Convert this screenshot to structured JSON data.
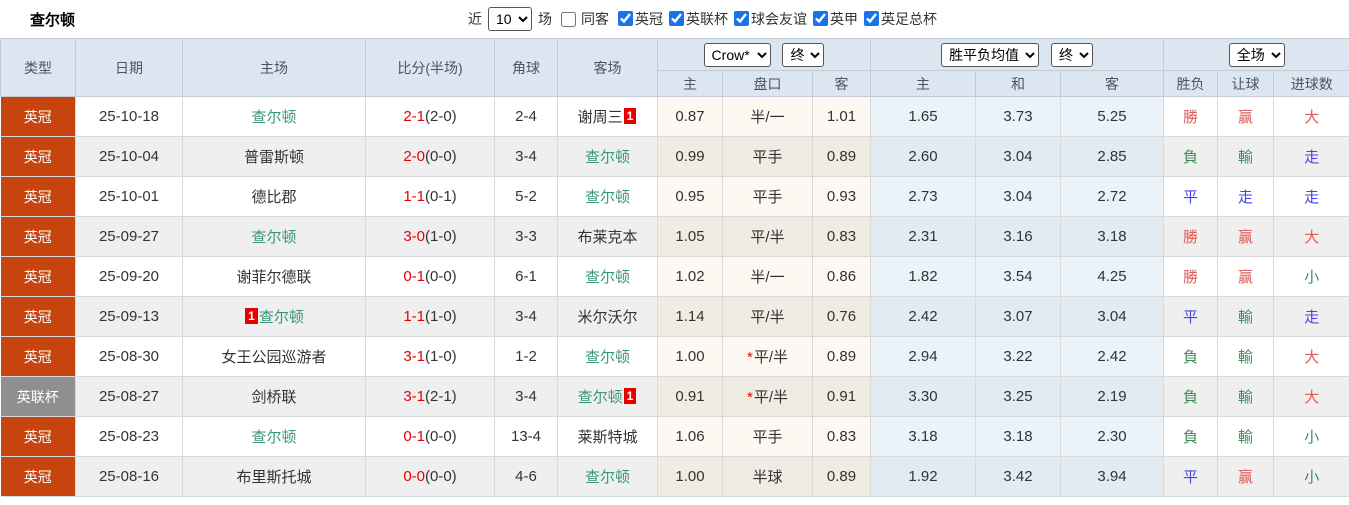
{
  "toolbar": {
    "title": "查尔顿",
    "recent_label": "近",
    "recent_value": "10",
    "games_label": "场",
    "same_venue_label": "同客",
    "same_venue_checked": false,
    "leagues": [
      {
        "label": "英冠",
        "checked": true
      },
      {
        "label": "英联杯",
        "checked": true
      },
      {
        "label": "球会友谊",
        "checked": true
      },
      {
        "label": "英甲",
        "checked": true
      },
      {
        "label": "英足总杯",
        "checked": true
      }
    ]
  },
  "table": {
    "headers": {
      "type": "类型",
      "date": "日期",
      "home": "主场",
      "score": "比分(半场)",
      "corner": "角球",
      "away": "客场",
      "odds_company_select": "Crow*",
      "odds_state_select": "终",
      "avg_select": "胜平负均值",
      "avg_state_select": "终",
      "scope_select": "全场",
      "odds_home": "主",
      "odds_handicap": "盘口",
      "odds_away": "客",
      "avg_home": "主",
      "avg_draw": "和",
      "avg_away": "客",
      "result": "胜负",
      "handicap_result": "让球",
      "goals_result": "进球数"
    },
    "rows": [
      {
        "league": "英冠",
        "league_style": "primary",
        "date": "25-10-18",
        "home": {
          "name": "查尔顿",
          "self": true,
          "badge": null,
          "badge_pos": null
        },
        "score_full": "2-1",
        "score_half": "(2-0)",
        "corner": "2-4",
        "away": {
          "name": "谢周三",
          "self": false,
          "badge": "1",
          "badge_pos": "after"
        },
        "odds_home": "0.87",
        "handicap": "半/一",
        "handicap_star": false,
        "odds_away": "1.01",
        "avg_home": "1.65",
        "avg_draw": "3.73",
        "avg_away": "5.25",
        "result": {
          "text": "勝",
          "color": "red"
        },
        "handicap_result": {
          "text": "赢",
          "color": "red"
        },
        "goals_result": {
          "text": "大",
          "color": "red"
        }
      },
      {
        "league": "英冠",
        "league_style": "primary",
        "date": "25-10-04",
        "home": {
          "name": "普雷斯顿",
          "self": false,
          "badge": null,
          "badge_pos": null
        },
        "score_full": "2-0",
        "score_half": "(0-0)",
        "corner": "3-4",
        "away": {
          "name": "查尔顿",
          "self": true,
          "badge": null,
          "badge_pos": null
        },
        "odds_home": "0.99",
        "handicap": "平手",
        "handicap_star": false,
        "odds_away": "0.89",
        "avg_home": "2.60",
        "avg_draw": "3.04",
        "avg_away": "2.85",
        "result": {
          "text": "負",
          "color": "green"
        },
        "handicap_result": {
          "text": "輸",
          "color": "green"
        },
        "goals_result": {
          "text": "走",
          "color": "blue"
        }
      },
      {
        "league": "英冠",
        "league_style": "primary",
        "date": "25-10-01",
        "home": {
          "name": "德比郡",
          "self": false,
          "badge": null,
          "badge_pos": null
        },
        "score_full": "1-1",
        "score_half": "(0-1)",
        "corner": "5-2",
        "away": {
          "name": "查尔顿",
          "self": true,
          "badge": null,
          "badge_pos": null
        },
        "odds_home": "0.95",
        "handicap": "平手",
        "handicap_star": false,
        "odds_away": "0.93",
        "avg_home": "2.73",
        "avg_draw": "3.04",
        "avg_away": "2.72",
        "result": {
          "text": "平",
          "color": "blue"
        },
        "handicap_result": {
          "text": "走",
          "color": "blue"
        },
        "goals_result": {
          "text": "走",
          "color": "blue"
        }
      },
      {
        "league": "英冠",
        "league_style": "primary",
        "date": "25-09-27",
        "home": {
          "name": "查尔顿",
          "self": true,
          "badge": null,
          "badge_pos": null
        },
        "score_full": "3-0",
        "score_half": "(1-0)",
        "corner": "3-3",
        "away": {
          "name": "布莱克本",
          "self": false,
          "badge": null,
          "badge_pos": null
        },
        "odds_home": "1.05",
        "handicap": "平/半",
        "handicap_star": false,
        "odds_away": "0.83",
        "avg_home": "2.31",
        "avg_draw": "3.16",
        "avg_away": "3.18",
        "result": {
          "text": "勝",
          "color": "red"
        },
        "handicap_result": {
          "text": "赢",
          "color": "red"
        },
        "goals_result": {
          "text": "大",
          "color": "red"
        }
      },
      {
        "league": "英冠",
        "league_style": "primary",
        "date": "25-09-20",
        "home": {
          "name": "谢菲尔德联",
          "self": false,
          "badge": null,
          "badge_pos": null
        },
        "score_full": "0-1",
        "score_half": "(0-0)",
        "corner": "6-1",
        "away": {
          "name": "查尔顿",
          "self": true,
          "badge": null,
          "badge_pos": null
        },
        "odds_home": "1.02",
        "handicap": "半/一",
        "handicap_star": false,
        "odds_away": "0.86",
        "avg_home": "1.82",
        "avg_draw": "3.54",
        "avg_away": "4.25",
        "result": {
          "text": "勝",
          "color": "red"
        },
        "handicap_result": {
          "text": "赢",
          "color": "red"
        },
        "goals_result": {
          "text": "小",
          "color": "green"
        }
      },
      {
        "league": "英冠",
        "league_style": "primary",
        "date": "25-09-13",
        "home": {
          "name": "查尔顿",
          "self": true,
          "badge": "1",
          "badge_pos": "before"
        },
        "score_full": "1-1",
        "score_half": "(1-0)",
        "corner": "3-4",
        "away": {
          "name": "米尔沃尔",
          "self": false,
          "badge": null,
          "badge_pos": null
        },
        "odds_home": "1.14",
        "handicap": "平/半",
        "handicap_star": false,
        "odds_away": "0.76",
        "avg_home": "2.42",
        "avg_draw": "3.07",
        "avg_away": "3.04",
        "result": {
          "text": "平",
          "color": "blue"
        },
        "handicap_result": {
          "text": "輸",
          "color": "green"
        },
        "goals_result": {
          "text": "走",
          "color": "blue"
        }
      },
      {
        "league": "英冠",
        "league_style": "primary",
        "date": "25-08-30",
        "home": {
          "name": "女王公园巡游者",
          "self": false,
          "badge": null,
          "badge_pos": null
        },
        "score_full": "3-1",
        "score_half": "(1-0)",
        "corner": "1-2",
        "away": {
          "name": "查尔顿",
          "self": true,
          "badge": null,
          "badge_pos": null
        },
        "odds_home": "1.00",
        "handicap": "平/半",
        "handicap_star": true,
        "odds_away": "0.89",
        "avg_home": "2.94",
        "avg_draw": "3.22",
        "avg_away": "2.42",
        "result": {
          "text": "負",
          "color": "green"
        },
        "handicap_result": {
          "text": "輸",
          "color": "green"
        },
        "goals_result": {
          "text": "大",
          "color": "red"
        }
      },
      {
        "league": "英联杯",
        "league_style": "alt",
        "date": "25-08-27",
        "home": {
          "name": "剑桥联",
          "self": false,
          "badge": null,
          "badge_pos": null
        },
        "score_full": "3-1",
        "score_half": "(2-1)",
        "corner": "3-4",
        "away": {
          "name": "查尔顿",
          "self": true,
          "badge": "1",
          "badge_pos": "after"
        },
        "odds_home": "0.91",
        "handicap": "平/半",
        "handicap_star": true,
        "odds_away": "0.91",
        "avg_home": "3.30",
        "avg_draw": "3.25",
        "avg_away": "2.19",
        "result": {
          "text": "負",
          "color": "green"
        },
        "handicap_result": {
          "text": "輸",
          "color": "green"
        },
        "goals_result": {
          "text": "大",
          "color": "red"
        }
      },
      {
        "league": "英冠",
        "league_style": "primary",
        "date": "25-08-23",
        "home": {
          "name": "查尔顿",
          "self": true,
          "badge": null,
          "badge_pos": null
        },
        "score_full": "0-1",
        "score_half": "(0-0)",
        "corner": "13-4",
        "away": {
          "name": "莱斯特城",
          "self": false,
          "badge": null,
          "badge_pos": null
        },
        "odds_home": "1.06",
        "handicap": "平手",
        "handicap_star": false,
        "odds_away": "0.83",
        "avg_home": "3.18",
        "avg_draw": "3.18",
        "avg_away": "2.30",
        "result": {
          "text": "負",
          "color": "green"
        },
        "handicap_result": {
          "text": "輸",
          "color": "green"
        },
        "goals_result": {
          "text": "小",
          "color": "green"
        }
      },
      {
        "league": "英冠",
        "league_style": "primary",
        "date": "25-08-16",
        "home": {
          "name": "布里斯托城",
          "self": false,
          "badge": null,
          "badge_pos": null
        },
        "score_full": "0-0",
        "score_half": "(0-0)",
        "corner": "4-6",
        "away": {
          "name": "查尔顿",
          "self": true,
          "badge": null,
          "badge_pos": null
        },
        "odds_home": "1.00",
        "handicap": "半球",
        "handicap_star": false,
        "odds_away": "0.89",
        "avg_home": "1.92",
        "avg_draw": "3.42",
        "avg_away": "3.94",
        "result": {
          "text": "平",
          "color": "blue"
        },
        "handicap_result": {
          "text": "赢",
          "color": "red"
        },
        "goals_result": {
          "text": "小",
          "color": "green"
        }
      }
    ]
  },
  "colors": {
    "league_primary": "#c8440e",
    "league_alt": "#8f8f8f",
    "self_team_green": "#3a9678",
    "score_red": "#e60000",
    "badge_red": "#e60000",
    "result_red": "#dd5a5a",
    "result_green": "#3e8e58",
    "result_blue": "#4343e8",
    "header_bg": "#dce6f1",
    "row_alt_bg": "#efefef",
    "odds_bg": "#fdf8f1",
    "avg_bg": "#eaf3fa"
  }
}
